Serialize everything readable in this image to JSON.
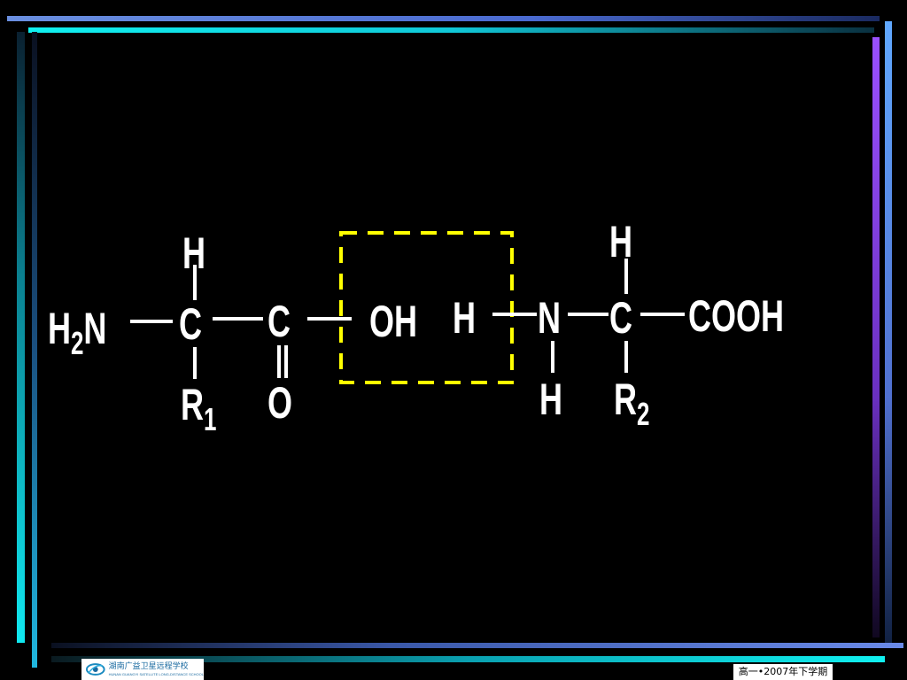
{
  "colors": {
    "background": "#000000",
    "text": "#ffffff",
    "highlight_box": "#ffff00",
    "frame_cyan": "#00e5f0",
    "frame_blue": "#5b7fd8",
    "frame_purple": "#8844ee"
  },
  "formula": {
    "left_amino": {
      "h": "H",
      "n_sub": "2",
      "n": "N"
    },
    "alpha_c1": {
      "top_h": "H",
      "c": "C",
      "r": "R",
      "r_sub": "1"
    },
    "carbonyl": {
      "c": "C",
      "o": "O"
    },
    "hydroxyl": "OH",
    "removed_h": "H",
    "amine_n": {
      "n": "N",
      "h": "H"
    },
    "alpha_c2": {
      "top_h": "H",
      "c": "C",
      "r": "R",
      "r_sub": "2"
    },
    "carboxyl": "COOH"
  },
  "footer": {
    "logo_text": "湖南广益卫星远程学校",
    "logo_subtext": "HUNAN GUANGYI SATELLITE LONG-DISTANCE SCHOOL",
    "term_label": "高一•2007年下学期"
  }
}
